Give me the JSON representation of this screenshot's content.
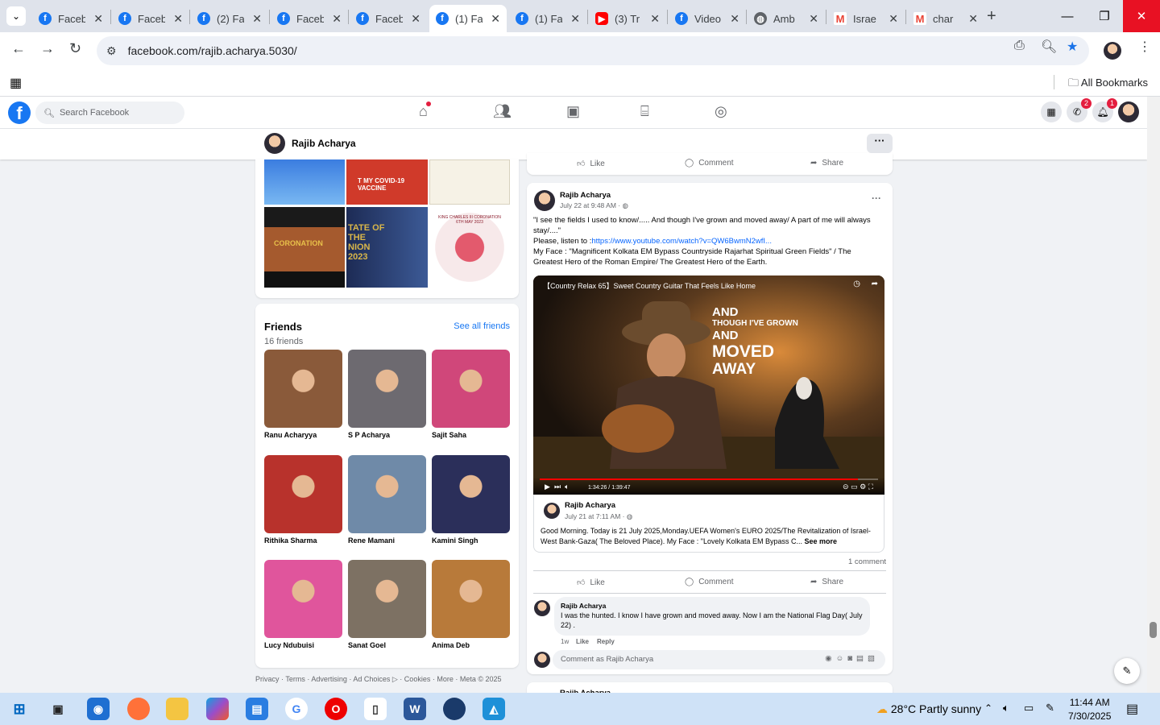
{
  "browser": {
    "tabs": [
      {
        "label": "Faceb",
        "icon": "facebook-icon",
        "x_kind": "fb"
      },
      {
        "label": "Faceb",
        "icon": "facebook-icon",
        "x_kind": "fb"
      },
      {
        "label": "(2) Fa",
        "icon": "facebook-icon",
        "x_kind": "fb"
      },
      {
        "label": "Faceb",
        "icon": "facebook-icon",
        "x_kind": "fb"
      },
      {
        "label": "Faceb",
        "icon": "facebook-icon",
        "x_kind": "fb"
      },
      {
        "label": "(1) Fa",
        "icon": "facebook-icon",
        "x_kind": "fb",
        "active": true
      },
      {
        "label": "(1) Fa",
        "icon": "facebook-icon",
        "x_kind": "fb"
      },
      {
        "label": "(3) Tr",
        "icon": "youtube-icon",
        "x_kind": "yt"
      },
      {
        "label": "Video",
        "icon": "facebook-icon",
        "x_kind": "fb"
      },
      {
        "label": "Amb",
        "icon": "globe-icon",
        "x_kind": "globe"
      },
      {
        "label": "Israe",
        "icon": "gmail-icon",
        "x_kind": "gm"
      },
      {
        "label": "char",
        "icon": "gmail-icon",
        "x_kind": "gm"
      }
    ],
    "url": "facebook.com/rajib.acharya.5030/",
    "all_bookmarks": "All Bookmarks"
  },
  "fb_header": {
    "search_placeholder": "Search Facebook",
    "messenger_badge": "2",
    "notifications_badge": "1"
  },
  "profile_bar": {
    "name": "Rajib Acharya"
  },
  "photos_card": {
    "captions": [
      "T MY COVID-19 VACCINE",
      "CORONATION",
      "TATE OF THE NION 2023",
      "KING CHARLES III CORONATION 6TH MAY 2023"
    ]
  },
  "friends": {
    "title": "Friends",
    "count": "16 friends",
    "see_all": "See all friends",
    "list": [
      {
        "name": "Ranu Acharyya",
        "color": "#8a5a3a"
      },
      {
        "name": "S P Acharya",
        "color": "#6d6a70"
      },
      {
        "name": "Sajit Saha",
        "color": "#d0477a"
      },
      {
        "name": "Rithika Sharma",
        "color": "#b8322c"
      },
      {
        "name": "Rene Mamani",
        "color": "#6f8aa8"
      },
      {
        "name": "Kamini Singh",
        "color": "#2b2f5a"
      },
      {
        "name": "Lucy Ndubuisi",
        "color": "#e0559c"
      },
      {
        "name": "Sanat Goel",
        "color": "#7d7163"
      },
      {
        "name": "Anima Deb",
        "color": "#b87a3a"
      }
    ]
  },
  "footer": "Privacy · Terms · Advertising · Ad Choices ▷ · Cookies · More · Meta © 2025",
  "actions": {
    "like": "Like",
    "comment": "Comment",
    "share": "Share"
  },
  "post": {
    "author": "Rajib Acharya",
    "time": "July 22 at 9:48 AM · ",
    "line1": "\"I see the fields I used to know/..... And though I've grown and moved away/ A part of me will always stay/....\"",
    "line2_prefix": "Please, listen to :",
    "link": "https://www.youtube.com/watch?v=QW6BwmN2wfI...",
    "line3": "My Face : \"Magnificent Kolkata EM Bypass Countryside Rajarhat Spiritual Green Fields\" / The Greatest Hero of the Roman Empire/ The Greatest Hero of the Earth.",
    "video_title": "【Country Relax 65】Sweet Country Guitar That Feels Like Home",
    "video_caption": [
      "AND",
      "THOUGH I'VE GROWN",
      "AND",
      "MOVED",
      "AWAY"
    ],
    "video_time": "1:34:26 / 1:39:47",
    "video_progress": 0.94,
    "shared_author": "Rajib Acharya",
    "shared_time": "July 21 at 7:11 AM · ",
    "shared_text": "Good Morning. Today is 21 July 2025,Monday.UEFA Women's EURO 2025/The Revitalization of Israel-West Bank-Gaza( The Beloved Place). My Face : \"Lovely Kolkata EM Bypass C...",
    "see_more": "See more",
    "comment_count": "1 comment",
    "comment_author": "Rajib Acharya",
    "comment_text": "I was the hunted. I know I have grown and moved away. Now I am the National Flag Day( July 22) .",
    "comment_age": "1w",
    "comment_like": "Like",
    "comment_reply": "Reply",
    "comment_placeholder": "Comment as Rajib Acharya",
    "next_author": "Rajib Acharya"
  },
  "taskbar": {
    "weather": "28°C  Partly sunny",
    "time": "11:44 AM",
    "date": "7/30/2025"
  }
}
